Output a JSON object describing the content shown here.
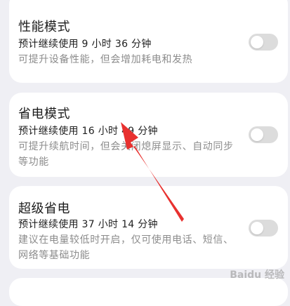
{
  "modes": [
    {
      "title": "性能模式",
      "estimate": "预计继续使用 9 小时 36 分钟",
      "description": "可提升设备性能，但会增加耗电和发热",
      "enabled": false
    },
    {
      "title": "省电模式",
      "estimate": "预计继续使用 16 小时 49 分钟",
      "description": "可提升续航时间，但会关闭熄屏显示、自动同步等功能",
      "enabled": false
    },
    {
      "title": "超级省电",
      "estimate": "预计继续使用 37 小时 14 分钟",
      "description": "建议在电量较低时开启，仅可使用电话、短信、网络等基础功能",
      "enabled": false
    }
  ],
  "annotation": {
    "arrow_color": "#e8312f"
  },
  "watermark": {
    "text": "Baidu 经验"
  },
  "colors": {
    "background": "#efeff4",
    "card": "#ffffff",
    "toggle_off": "#dcdcdc"
  }
}
